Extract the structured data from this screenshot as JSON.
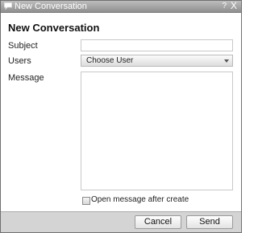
{
  "window": {
    "title": "New Conversation",
    "help_label": "?",
    "close_label": "X"
  },
  "form": {
    "heading": "New Conversation",
    "subject_label": "Subject",
    "subject_value": "",
    "users_label": "Users",
    "users_selected": "Choose User",
    "message_label": "Message",
    "message_value": "",
    "open_after_create_label": "Open message after create",
    "open_after_create_checked": false
  },
  "buttons": {
    "cancel_label": "Cancel",
    "send_label": "Send"
  },
  "colors": {
    "titlebar": "#9f9f9f",
    "footer": "#d4d4d4",
    "border": "#6f6f6f"
  }
}
